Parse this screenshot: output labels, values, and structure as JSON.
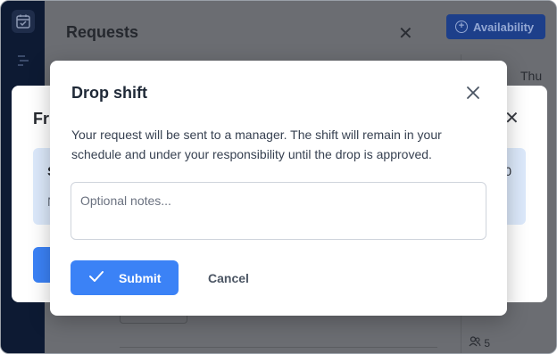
{
  "background": {
    "requests_title": "Requests",
    "availability_label": "Availability",
    "day_label": "Thu",
    "people_count": "5",
    "mid_dialog": {
      "title_fragment": "Fri",
      "card_initial": "S",
      "card_sub_initial": "N",
      "card_count_fragment": "0"
    }
  },
  "modal": {
    "title": "Drop shift",
    "message": "Your request will be sent to a manager. The shift will remain in your schedule and under your responsibility until the drop is approved.",
    "notes": {
      "value": "",
      "placeholder": "Optional notes..."
    },
    "submit_label": "Submit",
    "cancel_label": "Cancel"
  },
  "colors": {
    "primary": "#3b82f6",
    "rail": "#0d1a33",
    "card_bg": "#dce9fb"
  },
  "icons": {
    "close": "close-icon",
    "check": "check-icon",
    "calendar": "calendar-check-icon",
    "list": "list-icon",
    "add": "add-circle-icon",
    "people": "people-icon"
  }
}
